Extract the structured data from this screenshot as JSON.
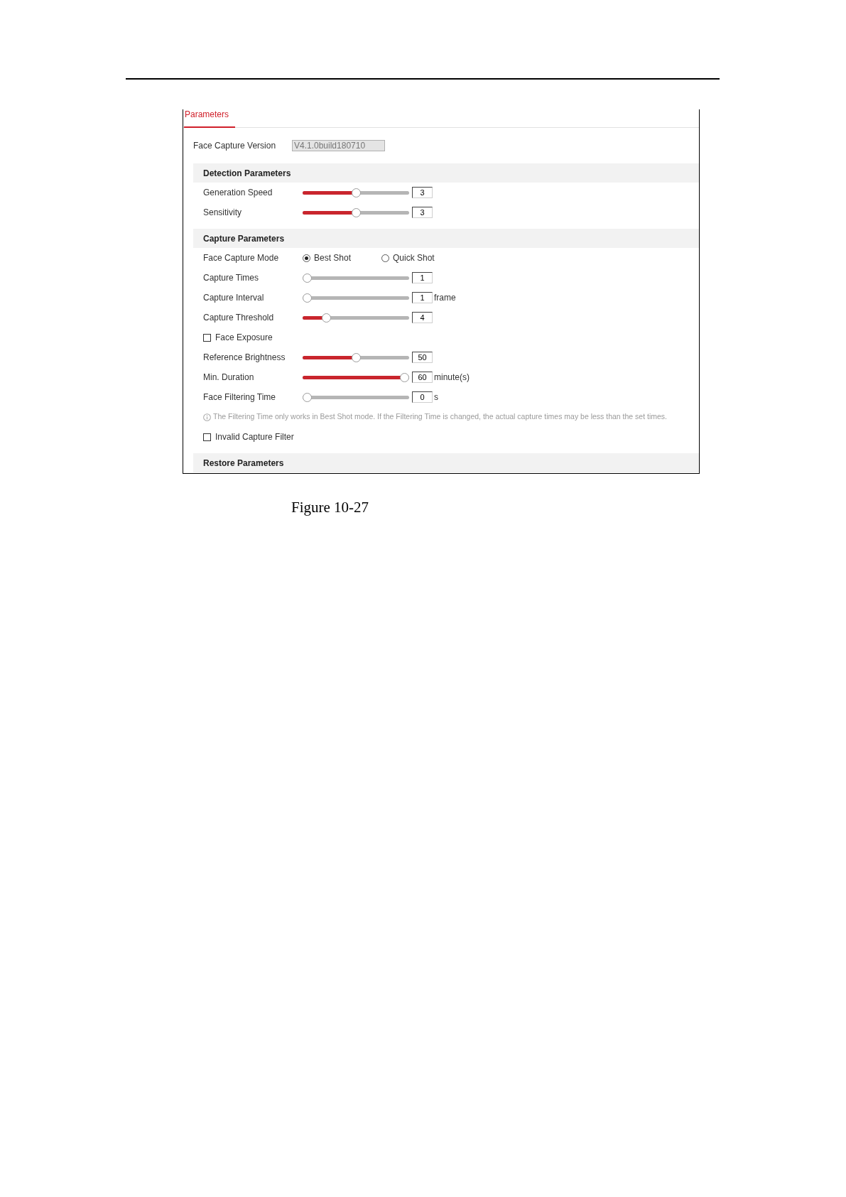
{
  "tabs": [
    {
      "label": "Parameters",
      "selected": true
    }
  ],
  "version": {
    "label": "Face Capture Version",
    "value": "V4.1.0build180710",
    "disabled": true
  },
  "sections": [
    {
      "title": "Detection Parameters",
      "rows": [
        {
          "kind": "slider",
          "label": "Generation Speed",
          "level": 0.5,
          "value": "3"
        },
        {
          "kind": "slider",
          "label": "Sensitivity",
          "level": 0.5,
          "value": "3"
        }
      ]
    },
    {
      "title": "Capture Parameters",
      "rows": [
        {
          "kind": "radio",
          "label": "Face Capture Mode",
          "options": [
            {
              "label": "Best Shot",
              "selected": true
            },
            {
              "label": "Quick Shot",
              "selected": false
            }
          ]
        },
        {
          "kind": "slider",
          "label": "Capture Times",
          "level": 0,
          "value": "1"
        },
        {
          "kind": "slider",
          "label": "Capture Interval",
          "level": 0,
          "value": "1",
          "unit": "frame"
        },
        {
          "kind": "slider",
          "label": "Capture Threshold",
          "level": 0.2,
          "value": "4"
        },
        {
          "kind": "checkbox",
          "label": "Face Exposure",
          "checked": false
        },
        {
          "kind": "slider",
          "label": "Reference Brightness",
          "level": 0.5,
          "value": "50"
        },
        {
          "kind": "slider",
          "label": "Min. Duration",
          "level": 1,
          "value": "60",
          "unit": "minute(s)"
        },
        {
          "kind": "slider",
          "label": "Face Filtering Time",
          "level": 0,
          "value": "0",
          "unit": "s"
        },
        {
          "kind": "note",
          "text": "The Filtering Time only works in Best Shot mode. If the Filtering Time is changed, the actual capture times may be less than the set times."
        },
        {
          "kind": "checkbox",
          "label": "Invalid Capture Filter",
          "checked": false
        }
      ]
    },
    {
      "title": "Restore Parameters"
    }
  ],
  "caption": "Figure 10-27"
}
